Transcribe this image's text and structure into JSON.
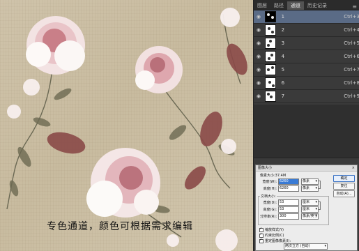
{
  "canvas": {
    "caption": "专色通道，颜色可根据需求编辑"
  },
  "panel": {
    "tabs": [
      {
        "label": "图层",
        "active": false
      },
      {
        "label": "路径",
        "active": false
      },
      {
        "label": "通道",
        "active": true
      },
      {
        "label": "历史记录",
        "active": false
      }
    ],
    "menu_icon": "≡",
    "channels": [
      {
        "name": "1",
        "shortcut": "Ctrl+3",
        "selected": true,
        "dark": true
      },
      {
        "name": "2",
        "shortcut": "Ctrl+4",
        "selected": false,
        "dark": false
      },
      {
        "name": "3",
        "shortcut": "Ctrl+5",
        "selected": false,
        "dark": false
      },
      {
        "name": "4",
        "shortcut": "Ctrl+6",
        "selected": false,
        "dark": false
      },
      {
        "name": "5",
        "shortcut": "Ctrl+7",
        "selected": false,
        "dark": false
      },
      {
        "name": "6",
        "shortcut": "Ctrl+8",
        "selected": false,
        "dark": false
      },
      {
        "name": "7",
        "shortcut": "Ctrl+9",
        "selected": false,
        "dark": false
      }
    ],
    "eye_icon": "👁"
  },
  "dialog": {
    "title": "图像大小",
    "close": "×",
    "pixel_size_label": "像素大小:37.4M",
    "width_label": "宽度(W):",
    "width_value": "6260",
    "width_unit": "像素",
    "height_label": "高度(H):",
    "height_value": "6260",
    "height_unit": "像素",
    "doc_size_label": "文档大小:",
    "doc_width_label": "宽度(D):",
    "doc_width_value": "53",
    "doc_width_unit": "厘米",
    "doc_height_label": "高度(G):",
    "doc_height_value": "53",
    "doc_height_unit": "厘米",
    "resolution_label": "分辨率(R):",
    "resolution_value": "300",
    "resolution_unit": "像素/英寸",
    "opt_scale_styles": "缩放样式(Y)",
    "opt_constrain": "约束比例(C)",
    "opt_resample": "重定图像像素(I):",
    "resample_method": "两次立方 (自动)",
    "ok": "确定",
    "reset": "复位",
    "auto": "自动(A)..."
  }
}
